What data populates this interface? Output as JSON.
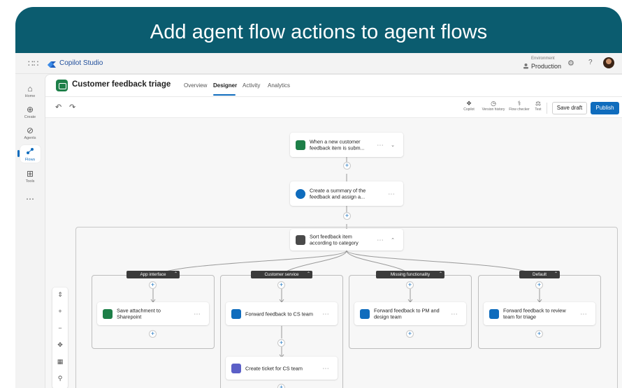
{
  "banner": {
    "title": "Add agent flow actions to agent flows"
  },
  "topbar": {
    "brand": "Copilot Studio",
    "environment_label": "Environment",
    "environment_value": "Production"
  },
  "rail": {
    "items": [
      {
        "label": "Home",
        "icon": "home-icon"
      },
      {
        "label": "Create",
        "icon": "plus-circle-icon"
      },
      {
        "label": "Agents",
        "icon": "agent-icon"
      },
      {
        "label": "Flows",
        "icon": "flows-icon",
        "active": true
      },
      {
        "label": "Tools",
        "icon": "tools-icon"
      }
    ]
  },
  "header": {
    "title": "Customer feedback triage",
    "tabs": [
      {
        "label": "Overview"
      },
      {
        "label": "Designer",
        "active": true
      },
      {
        "label": "Activity"
      },
      {
        "label": "Analytics"
      }
    ]
  },
  "toolbar": {
    "tools": [
      {
        "label": "Copilot"
      },
      {
        "label": "Version history"
      },
      {
        "label": "Flow checker"
      },
      {
        "label": "Test"
      }
    ],
    "save_label": "Save draft",
    "publish_label": "Publish"
  },
  "flow": {
    "trigger": "When a new customer feedback item is subm...",
    "step2": "Create a summary of the feedback and assign a...",
    "switch": "Sort feedback item according to category",
    "branches": [
      {
        "label": "App interface",
        "action": "Save attachment to Sharepoint"
      },
      {
        "label": "Customer service",
        "action": "Forward feedback to CS team",
        "action2": "Create ticket for CS team"
      },
      {
        "label": "Missing functionality",
        "action": "Forward feedback to PM and design team"
      },
      {
        "label": "Default",
        "action": "Forward feedback to review team for triage"
      }
    ]
  },
  "colors": {
    "banner": "#0b5c6f",
    "accent": "#0f6cbd",
    "excel_green": "#1d7f48",
    "teams_purple": "#5b5fc7"
  }
}
